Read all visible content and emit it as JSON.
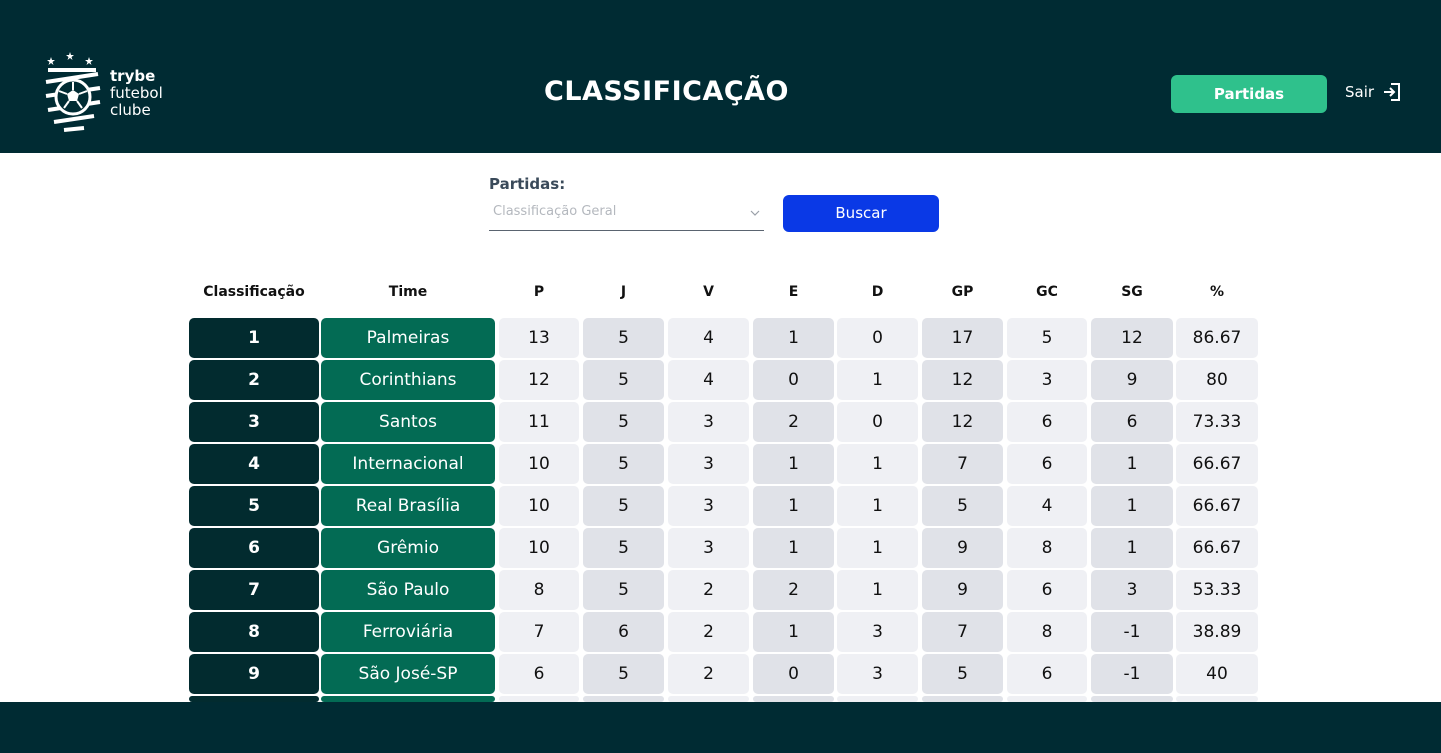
{
  "brand": {
    "line1": "trybe",
    "line2": "futebol",
    "line3": "clube"
  },
  "header": {
    "title": "CLASSIFICAÇÃO",
    "partidas_button": "Partidas",
    "logout_label": "Sair"
  },
  "filter": {
    "label": "Partidas:",
    "selected": "Classificação Geral",
    "search_button": "Buscar"
  },
  "table": {
    "headers": [
      "Classificação",
      "Time",
      "P",
      "J",
      "V",
      "E",
      "D",
      "GP",
      "GC",
      "SG",
      "%"
    ],
    "rows": [
      [
        "1",
        "Palmeiras",
        "13",
        "5",
        "4",
        "1",
        "0",
        "17",
        "5",
        "12",
        "86.67"
      ],
      [
        "2",
        "Corinthians",
        "12",
        "5",
        "4",
        "0",
        "1",
        "12",
        "3",
        "9",
        "80"
      ],
      [
        "3",
        "Santos",
        "11",
        "5",
        "3",
        "2",
        "0",
        "12",
        "6",
        "6",
        "73.33"
      ],
      [
        "4",
        "Internacional",
        "10",
        "5",
        "3",
        "1",
        "1",
        "7",
        "6",
        "1",
        "66.67"
      ],
      [
        "5",
        "Real Brasília",
        "10",
        "5",
        "3",
        "1",
        "1",
        "5",
        "4",
        "1",
        "66.67"
      ],
      [
        "6",
        "Grêmio",
        "10",
        "5",
        "3",
        "1",
        "1",
        "9",
        "8",
        "1",
        "66.67"
      ],
      [
        "7",
        "São Paulo",
        "8",
        "5",
        "2",
        "2",
        "1",
        "9",
        "6",
        "3",
        "53.33"
      ],
      [
        "8",
        "Ferroviária",
        "7",
        "6",
        "2",
        "1",
        "3",
        "7",
        "8",
        "-1",
        "38.89"
      ],
      [
        "9",
        "São José-SP",
        "6",
        "5",
        "2",
        "0",
        "3",
        "5",
        "6",
        "-1",
        "40"
      ],
      [
        "",
        "",
        "",
        "",
        "",
        "",
        "",
        "",
        "",
        "",
        ""
      ]
    ]
  },
  "colors": {
    "header_bg": "#002b33",
    "rank_bg": "#022b2f",
    "team_bg": "#036b54",
    "partidas_button": "#2fc18c",
    "search_button": "#0a39e6"
  },
  "icons": {
    "logo": "soccer-ball-shield-icon",
    "logout": "logout-icon",
    "chevron": "chevron-down-icon"
  }
}
